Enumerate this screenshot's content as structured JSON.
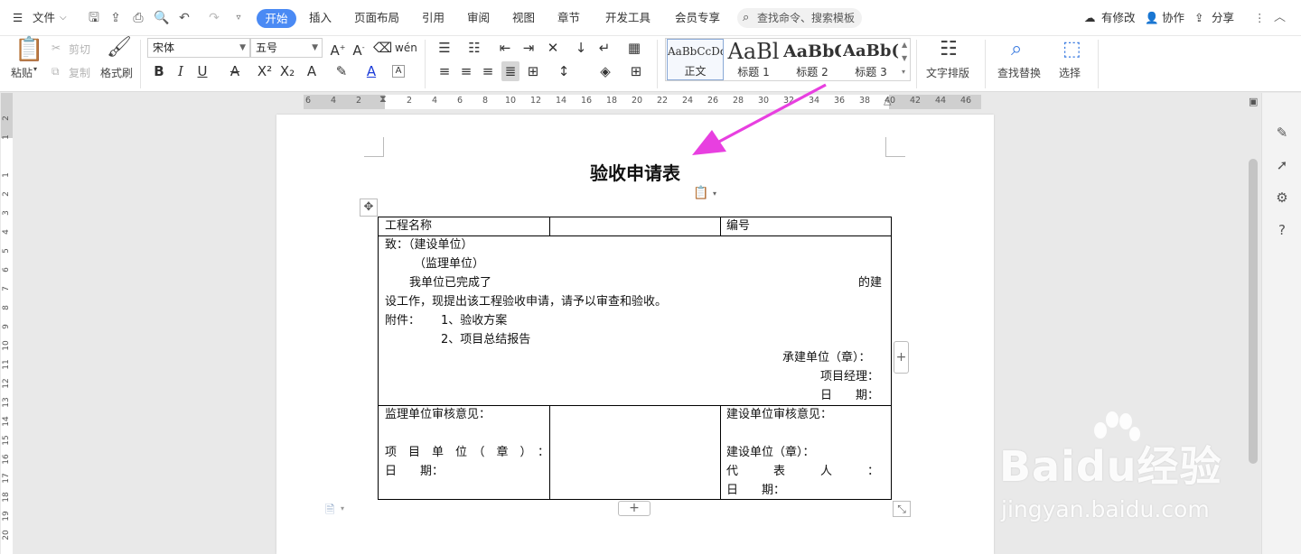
{
  "menubar": {
    "file_label": "文件",
    "tabs": [
      "开始",
      "插入",
      "页面布局",
      "引用",
      "审阅",
      "视图",
      "章节",
      "开发工具",
      "会员专享"
    ],
    "active_tab": "开始",
    "search_placeholder": "查找命令、搜索模板",
    "right": {
      "modified": "有修改",
      "collaborate": "协作",
      "share": "分享"
    }
  },
  "ribbon": {
    "paste": "粘贴",
    "cut": "剪切",
    "copy": "复制",
    "format_painter": "格式刷",
    "font_name": "宋体",
    "font_size": "五号",
    "styles": [
      {
        "preview": "AaBbCcDd",
        "label": "正文"
      },
      {
        "preview": "AaBl",
        "label": "标题 1"
      },
      {
        "preview": "AaBbC",
        "label": "标题 2"
      },
      {
        "preview": "AaBb(",
        "label": "标题 3"
      }
    ],
    "text_layout": "文字排版",
    "find_replace": "查找替换",
    "select": "选择"
  },
  "ruler": {
    "h_numbers": [
      "6",
      "4",
      "2",
      "2",
      "4",
      "6",
      "8",
      "10",
      "12",
      "14",
      "16",
      "18",
      "20",
      "22",
      "24",
      "26",
      "28",
      "30",
      "32",
      "34",
      "36",
      "38",
      "40",
      "42",
      "44",
      "46"
    ],
    "v_numbers": [
      "2",
      "1",
      "1",
      "2",
      "3",
      "4",
      "5",
      "6",
      "7",
      "8",
      "9",
      "10",
      "11",
      "12",
      "13",
      "14",
      "15",
      "16",
      "17",
      "18",
      "19",
      "20"
    ]
  },
  "document": {
    "title": "验收申请表",
    "table": {
      "project_name_label": "工程名称",
      "number_label": "编号",
      "to_line": "致：（建设单位）",
      "supervisor_line": "（监理单位）",
      "completed_line": "我单位已完成了",
      "completed_suffix": "的建",
      "request_line": "设工作，现提出该工程验收申请，请予以审查和验收。",
      "attachment_label": "附件：",
      "attachment_1": "1、验收方案",
      "attachment_2": "2、项目总结报告",
      "contractor_seal": "承建单位（章）：",
      "project_manager": "项目经理：",
      "date_right": "日　　期：",
      "supervisor_opinion": "监理单位审核意见：",
      "project_unit_seal": "项　目　单　位　（　章　）　：",
      "date_left": "日　　期：",
      "builder_opinion": "建设单位审核意见：",
      "builder_seal": "建设单位（章）：",
      "representative": "代　　　表　　　人　　　：",
      "date_builder": "日　　期："
    }
  },
  "watermark": {
    "brand": "Baidu经验",
    "url": "jingyan.baidu.com"
  },
  "colors": {
    "accent": "#4a8af4",
    "arrow": "#e83fe0"
  }
}
